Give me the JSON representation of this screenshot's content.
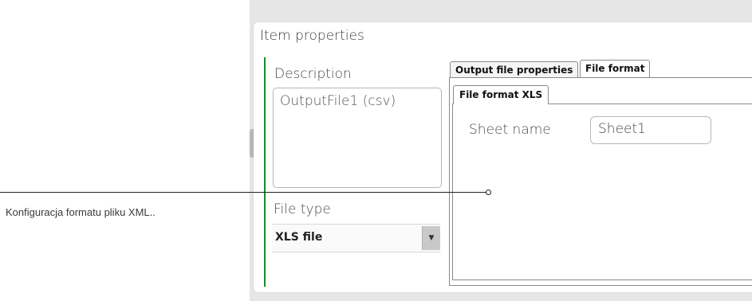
{
  "panel": {
    "title": "Item properties"
  },
  "description": {
    "label": "Description",
    "value": "OutputFile1 (csv)"
  },
  "file_type": {
    "label": "File type",
    "selected": "XLS file"
  },
  "tabs": [
    {
      "label": "Output file properties",
      "active": false
    },
    {
      "label": "File format",
      "active": true
    }
  ],
  "inner_tabs": [
    {
      "label": "File format XLS",
      "active": true
    }
  ],
  "sheet": {
    "label": "Sheet name",
    "value": "Sheet1"
  },
  "annotation": {
    "text": "Konfiguracja formatu pliku XML.."
  },
  "colors": {
    "accent_line": "#1a8a2b"
  }
}
